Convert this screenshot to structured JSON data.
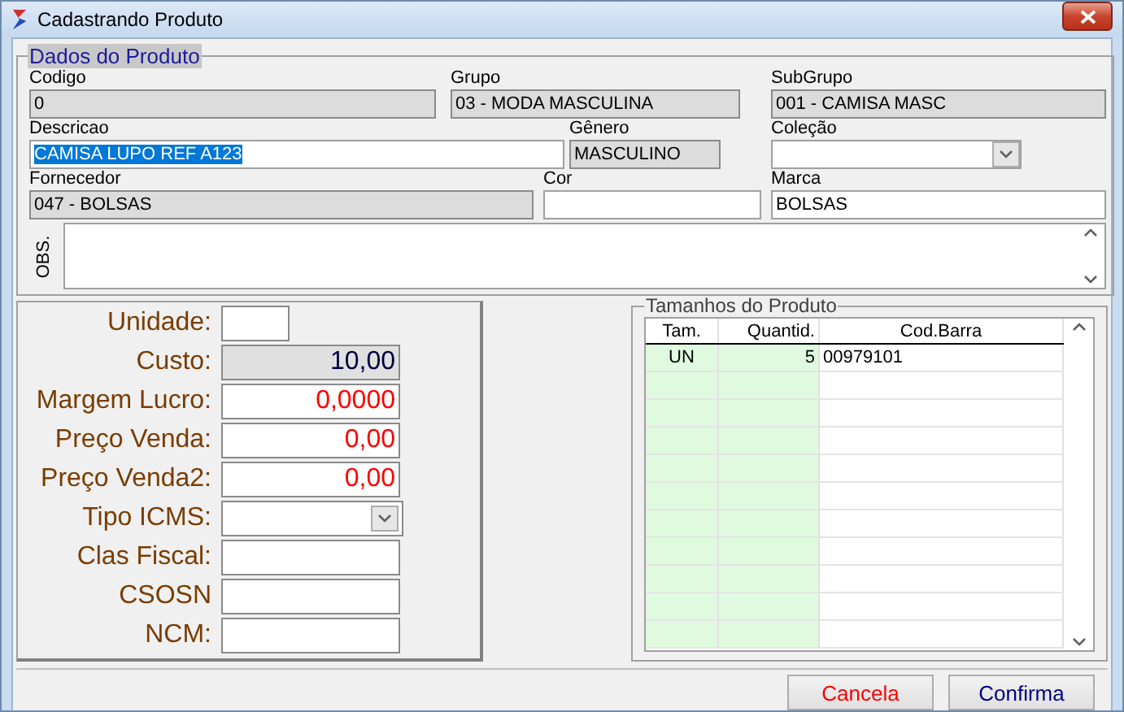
{
  "window": {
    "title": "Cadastrando Produto"
  },
  "product_data": {
    "legend": "Dados do Produto",
    "rows": [
      [
        {
          "label": "Codigo",
          "value": "0",
          "kind": "readonly"
        },
        {
          "label": "Grupo",
          "value": "03 - MODA MASCULINA",
          "kind": "readonly"
        },
        {
          "label": "SubGrupo",
          "value": "001 - CAMISA MASC",
          "kind": "readonly"
        }
      ],
      [
        {
          "label": "Descricao",
          "value": "CAMISA LUPO REF A123",
          "kind": "input",
          "text_selected": true
        },
        {
          "label": "Gênero",
          "value": "MASCULINO",
          "kind": "readonly"
        },
        {
          "label": "Coleção",
          "kind": "select"
        }
      ],
      [
        {
          "label": "Fornecedor",
          "value": "047 - BOLSAS",
          "kind": "readonly"
        },
        {
          "label": "Cor",
          "kind": "input"
        },
        {
          "label": "Marca",
          "value": "BOLSAS",
          "kind": "input"
        }
      ]
    ],
    "obs": {
      "label": "OBS."
    }
  },
  "pricing": {
    "fields": [
      {
        "label": "Unidade:",
        "kind": "input"
      },
      {
        "label": "Custo:",
        "value": "10,00",
        "kind": "readonly",
        "color": "#000040"
      },
      {
        "label": "Margem Lucro:",
        "value": "0,0000",
        "kind": "input",
        "color": "#ff0000"
      },
      {
        "label": "Preço Venda:",
        "value": "0,00",
        "kind": "input",
        "color": "#ff0000"
      },
      {
        "label": "Preço Venda2:",
        "value": "0,00",
        "kind": "input",
        "color": "#ff0000"
      },
      {
        "label": "Tipo ICMS:",
        "kind": "select"
      },
      {
        "label": "Clas Fiscal:",
        "kind": "input"
      },
      {
        "label": "CSOSN",
        "kind": "input"
      },
      {
        "label": "NCM:",
        "kind": "input"
      }
    ]
  },
  "sizes": {
    "legend": "Tamanhos do Produto",
    "columns": [
      "Tam.",
      "Quantid.",
      "Cod.Barra"
    ],
    "rows": [
      [
        "UN",
        "5",
        "00979101"
      ]
    ]
  },
  "buttons": [
    {
      "label": "Cancela",
      "color": "#ff0000"
    },
    {
      "label": "Confirma",
      "color": "#000080"
    }
  ]
}
